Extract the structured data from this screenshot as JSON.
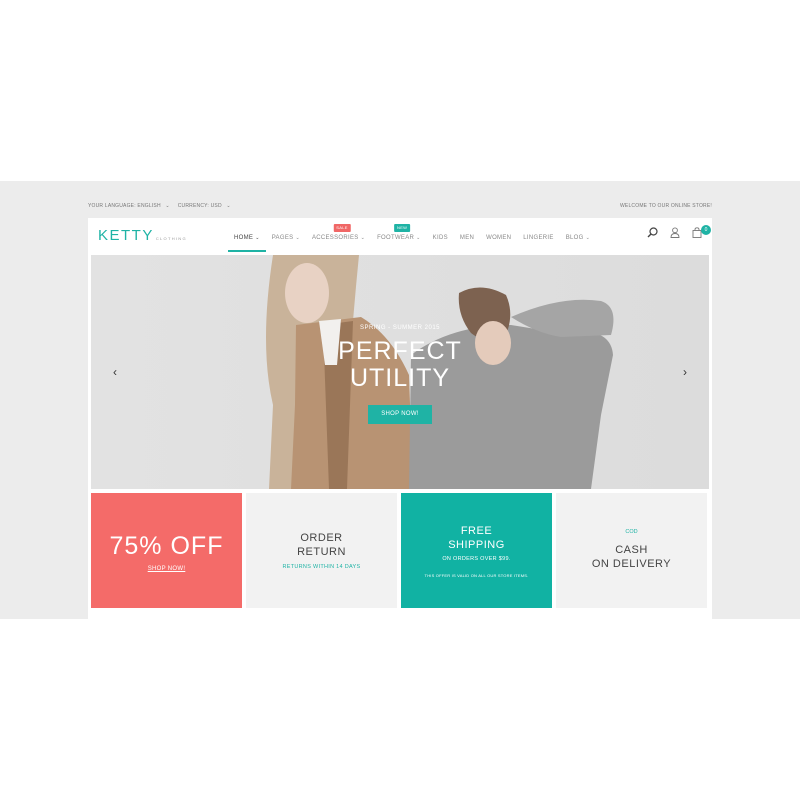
{
  "topbar": {
    "language_label": "YOUR LANGUAGE:",
    "language_value": "ENGLISH",
    "currency_label": "CURRENCY:",
    "currency_value": "USD",
    "welcome": "WELCOME TO OUR ONLINE STORE!"
  },
  "logo": {
    "name": "KETTY",
    "sub": "CLOTHING"
  },
  "nav": {
    "items": [
      {
        "label": "HOME",
        "has_dropdown": true,
        "active": true
      },
      {
        "label": "PAGES",
        "has_dropdown": true
      },
      {
        "label": "ACCESSORIES",
        "has_dropdown": true,
        "badge": "SALE"
      },
      {
        "label": "FOOTWEAR",
        "has_dropdown": true,
        "badge": "NEW"
      },
      {
        "label": "KIDS"
      },
      {
        "label": "MEN"
      },
      {
        "label": "WOMEN"
      },
      {
        "label": "LINGERIE"
      },
      {
        "label": "BLOG",
        "has_dropdown": true
      }
    ]
  },
  "header_icons": {
    "search": "search-icon",
    "account": "user-icon",
    "cart": "bag-icon",
    "cart_count": "0"
  },
  "hero": {
    "kicker": "SPRING - SUMMER 2015",
    "title_line1": "PERFECT",
    "title_line2": "UTILITY",
    "button": "SHOP NOW!",
    "prev": "‹",
    "next": "›"
  },
  "promos": {
    "sale": {
      "title": "75% OFF",
      "link": "SHOP NOW!"
    },
    "returns": {
      "line1": "ORDER",
      "line2": "RETURN",
      "sub": "RETURNS WITHIN 14 DAYS"
    },
    "shipping": {
      "line1": "FREE",
      "line2": "SHIPPING",
      "sub": "ON ORDERS OVER $99.",
      "note": "THIS OFFER IS VALID ON ALL OUR STORE ITEMS."
    },
    "cod": {
      "kicker": "COD",
      "line1": "CASH",
      "line2": "ON DELIVERY"
    }
  },
  "colors": {
    "accent": "#1fb3a5",
    "sale": "#f46b69",
    "band": "#ececec"
  }
}
